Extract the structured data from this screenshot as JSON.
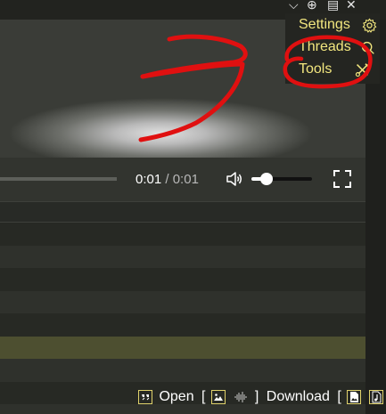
{
  "window_controls": {
    "icons": [
      "chevron-down-icon",
      "add-circle-icon",
      "list-icon",
      "close-icon"
    ],
    "glyphs": [
      "⌵",
      "⊕",
      "▤",
      "✕"
    ]
  },
  "menu": {
    "items": [
      {
        "label": "Settings",
        "icon": "gear-icon"
      },
      {
        "label": "Threads",
        "icon": "search-icon"
      },
      {
        "label": "Tools",
        "icon": "tools-icon"
      }
    ],
    "text_color": "#f2e67e"
  },
  "player": {
    "current_time": "0:01",
    "separator": " / ",
    "duration": "0:01",
    "playback_progress": 1.0,
    "volume_level": 0.25
  },
  "rows": {
    "colors": [
      "#272924",
      "#2f312c",
      "#272924",
      "#2f312c",
      "#272924",
      "#4d4f30",
      "#2f312c",
      "#272924",
      "#2f312c"
    ],
    "highlight_color": "#4d4f30"
  },
  "bottom_bar": {
    "open_label": "Open",
    "download_label": "Download",
    "bracket_open": "[",
    "bracket_close": "]",
    "icons": [
      "reply-icon",
      "image-icon",
      "audio-wave-icon",
      "image-file-icon",
      "music-file-icon"
    ]
  },
  "annotation": {
    "color": "#e01010"
  }
}
